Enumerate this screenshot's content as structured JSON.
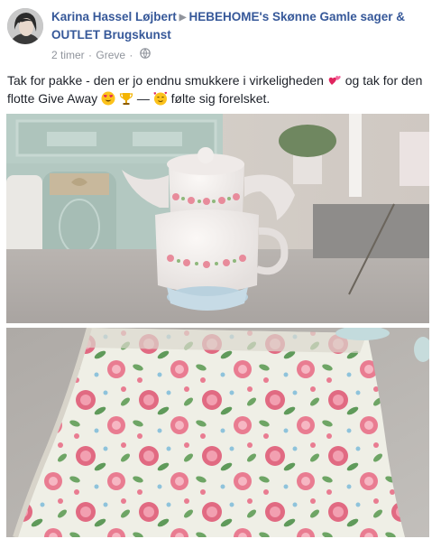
{
  "post": {
    "author_name": "Karina Hassel Løjbert",
    "group_name": "HEBEHOME's Skønne Gamle sager & OUTLET Brugskunst",
    "timestamp": "2 timer",
    "location": "Greve",
    "audience_icon": "globe-icon",
    "text_part1": "Tak for pakke - den er jo endnu smukkere i virkeligheden",
    "text_part2": " og tak for den flotte Give Away",
    "text_part3": " — ",
    "text_part4": "følte sig forelsket.",
    "emojis": [
      "two-hearts-emoji",
      "heart-eyes-emoji",
      "trophy-emoji",
      "smiling-hearts-emoji"
    ],
    "photo_count": 2
  },
  "colors": {
    "link": "#365899",
    "meta": "#90949c",
    "text": "#1d2129"
  }
}
